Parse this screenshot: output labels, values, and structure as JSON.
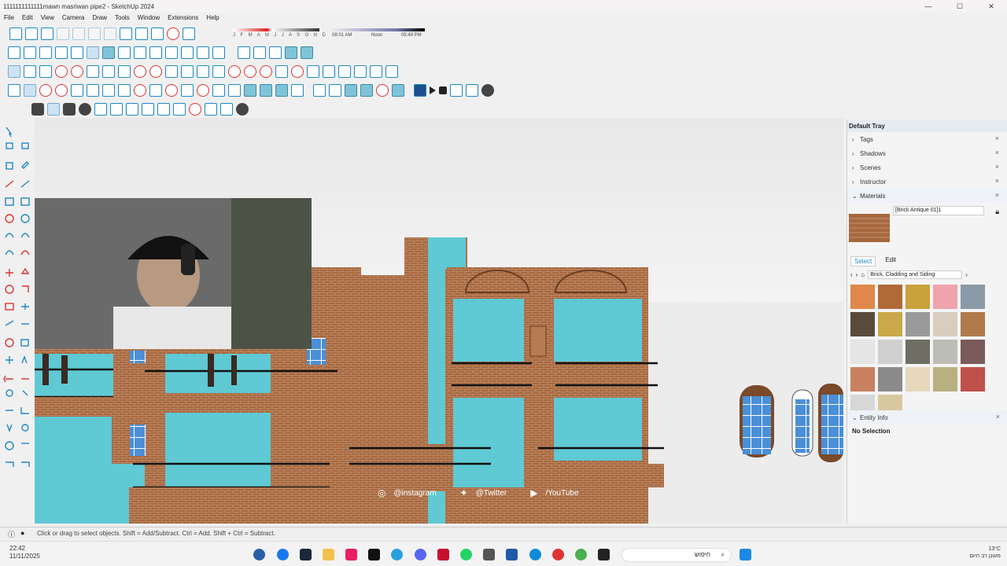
{
  "window": {
    "title": "1111111111111mawn masriwan pipe2 - SketchUp 2024",
    "minimize": "—",
    "close": "✕"
  },
  "menu": [
    "File",
    "Edit",
    "View",
    "Camera",
    "Draw",
    "Tools",
    "Window",
    "Extensions",
    "Help"
  ],
  "shadows": {
    "months": "J F M A M J J A S O N D",
    "time_start": "08:01 AM",
    "time_mid": "Noon",
    "time_end": "05:49 PM"
  },
  "tray": {
    "title": "Default Tray",
    "panels": [
      "Tags",
      "Shadows",
      "Scenes",
      "Instructor",
      "Materials"
    ],
    "material_name": "[Brick Antique 01]1",
    "tabs": [
      "Select",
      "Edit"
    ],
    "library": "Brick, Cladding and Siding",
    "entity_info": "Entity Info",
    "no_selection": "No Selection",
    "swatches": [
      "#e0884a",
      "#b06a3a",
      "#c9a23b",
      "#f0a3ac",
      "#8a9aa8",
      "#5a4a3a",
      "#c9a94a",
      "#9a9a9a",
      "#d8cdbf",
      "#b07a4a",
      "#e5e5e5",
      "#cfcfcf",
      "#6e6e64",
      "#bdbdb5",
      "#7a5a5a",
      "#c98060",
      "#8a8a8a",
      "#e6d7bd",
      "#b8b080",
      "#c0504a",
      "#d7d7d7",
      "#d8c8a0"
    ]
  },
  "status": "Click or drag to select objects. Shift = Add/Subtract. Ctrl = Add. Shift + Ctrl = Subtract.",
  "social": {
    "instagram": "@instagram",
    "twitter": "@Twitter",
    "youtube": "/YouTube"
  },
  "taskbar": {
    "time": "22:42",
    "date": "11/11/2025",
    "search": "חיפוש",
    "temp": "13°C",
    "weather": "מעונן רב היום"
  },
  "colors": {
    "glass": "#5fc9d4",
    "brick": "#a8683f",
    "accent": "#1e88c8"
  }
}
